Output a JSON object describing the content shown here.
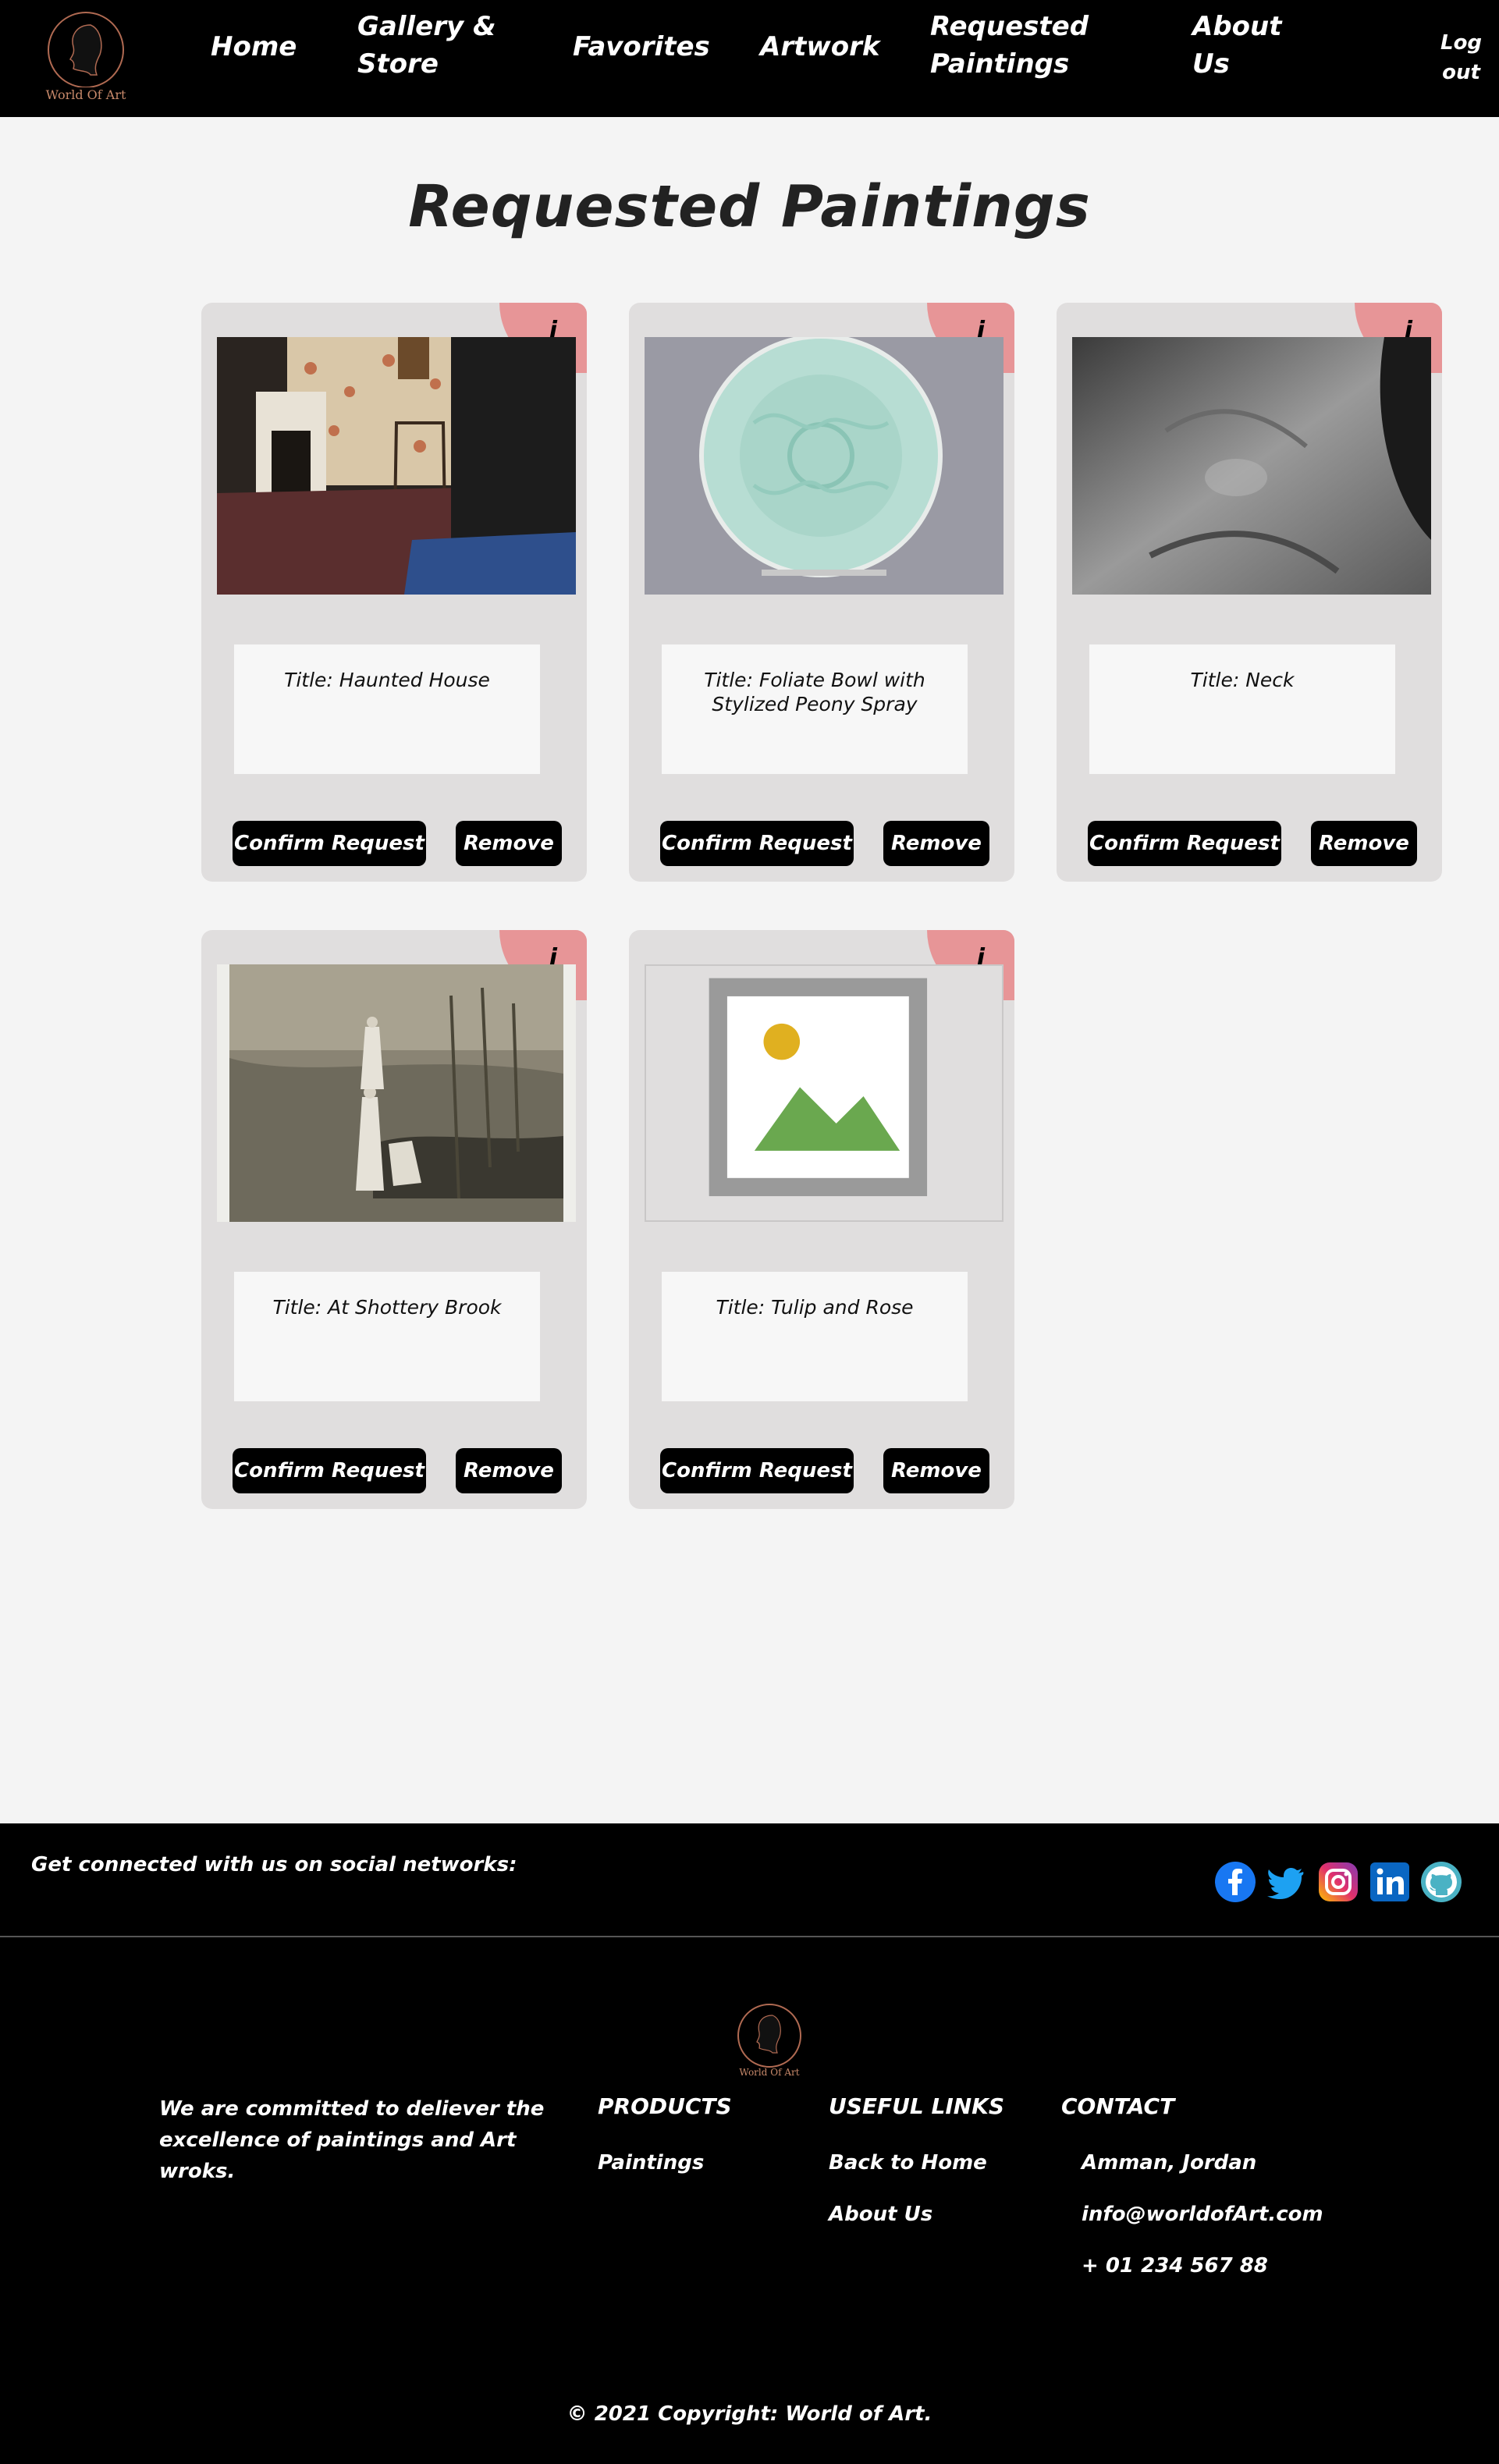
{
  "nav": {
    "logo_text": "World Of Art",
    "home": "Home",
    "gallery_line1": "Gallery &",
    "gallery_line2": "Store",
    "favorites": "Favorites",
    "artwork": "Artwork",
    "requested_line1": "Requested",
    "requested_line2": "Paintings",
    "about_line1": "About",
    "about_line2": "Us",
    "logout_line1": "Log",
    "logout_line2": "out"
  },
  "page": {
    "title": "Requested Paintings"
  },
  "cards": [
    {
      "info": "i",
      "title": "Title: Haunted House",
      "confirm": "Confirm Request",
      "remove": "Remove"
    },
    {
      "info": "i",
      "title": "Title: Foliate Bowl with Stylized Peony Spray",
      "confirm": "Confirm Request",
      "remove": "Remove"
    },
    {
      "info": "i",
      "title": "Title: Neck",
      "confirm": "Confirm Request",
      "remove": "Remove"
    },
    {
      "info": "i",
      "title": "Title: At Shottery Brook",
      "confirm": "Confirm Request",
      "remove": "Remove"
    },
    {
      "info": "i",
      "title": "Title: Tulip and Rose",
      "confirm": "Confirm Request",
      "remove": "Remove"
    }
  ],
  "social": {
    "text": "Get connected with us on social networks:",
    "icons": [
      "facebook-icon",
      "twitter-icon",
      "instagram-icon",
      "linkedin-icon",
      "github-icon"
    ]
  },
  "footer": {
    "logo_text": "World Of Art",
    "mission": "We are committed to deliever the excellence of paintings and Art wroks.",
    "products_head": "PRODUCTS",
    "products_links": [
      "Paintings"
    ],
    "useful_head": "USEFUL LINKS",
    "useful_links": [
      "Back to Home",
      "About Us"
    ],
    "contact_head": "CONTACT",
    "contact_items": [
      "Amman, Jordan",
      "info@worldofArt.com",
      "+ 01 234 567 88"
    ],
    "copyright": "© 2021 Copyright: World of Art."
  },
  "colors": {
    "nav_bg": "#000000",
    "page_bg": "#f4f4f4",
    "card_bg": "#e0dede",
    "info_badge": "#e79597",
    "button_bg": "#000000"
  }
}
